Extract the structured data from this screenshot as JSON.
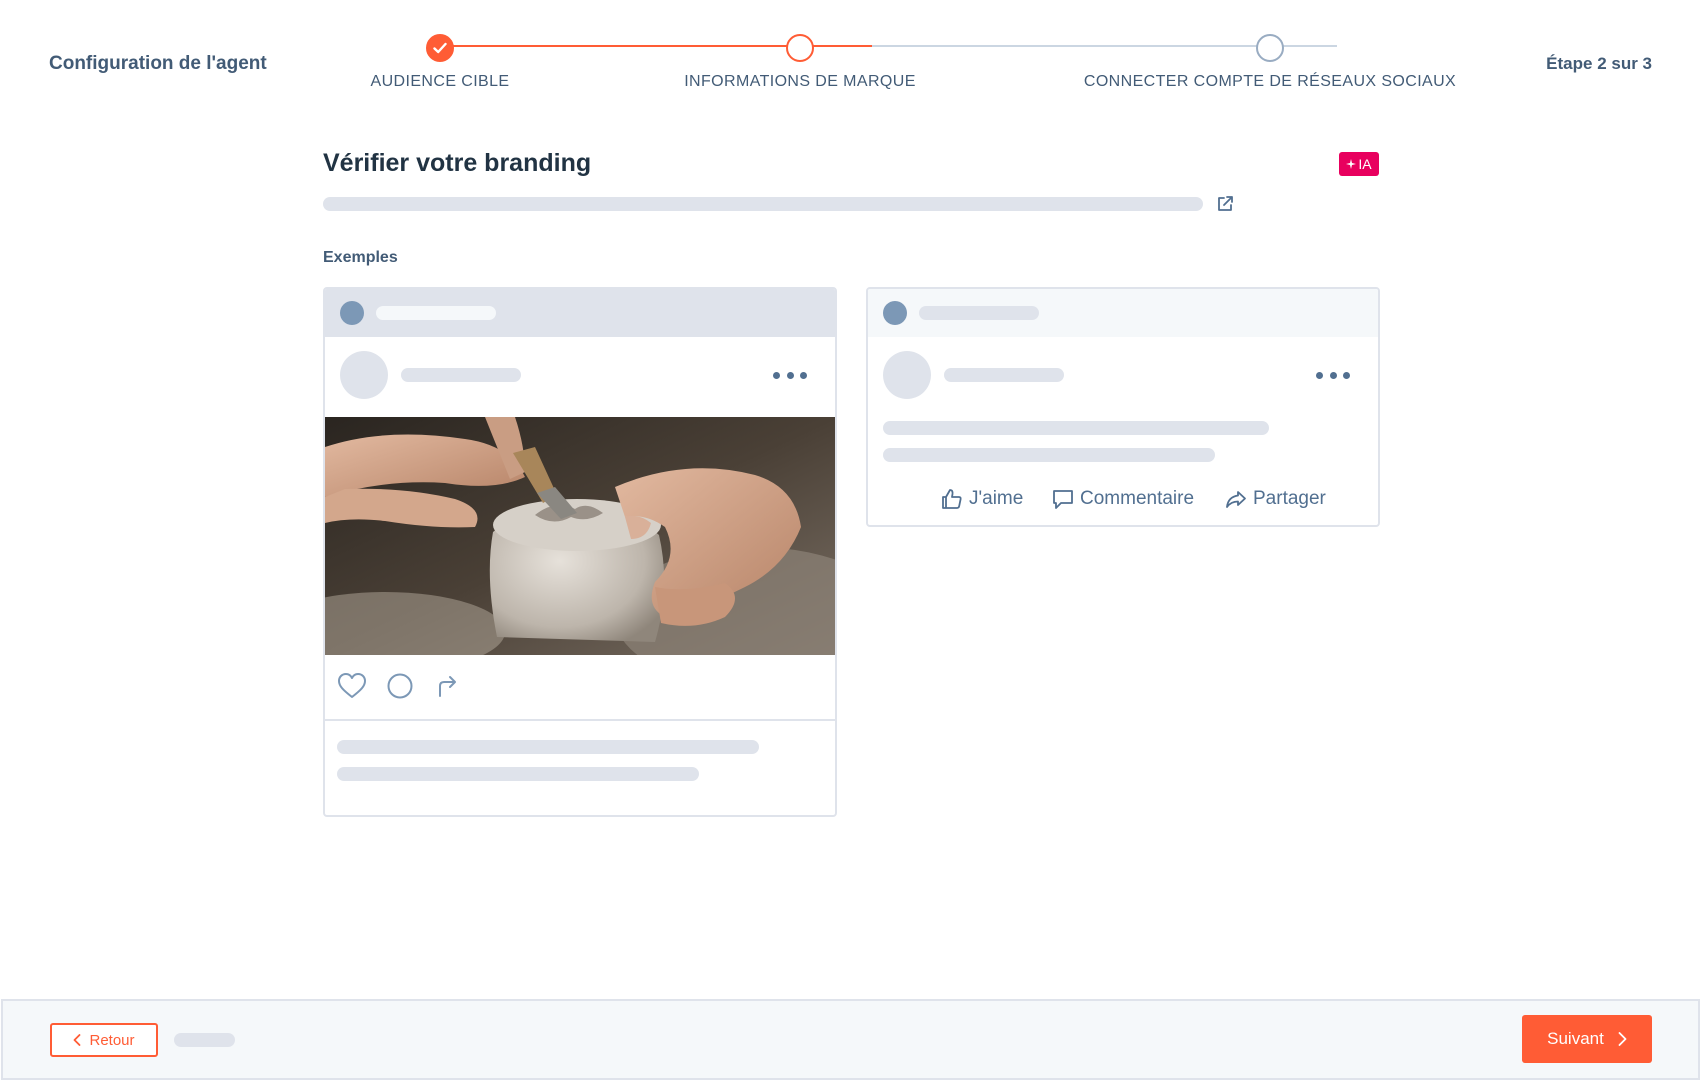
{
  "header": {
    "app_title": "Configuration de l'agent",
    "step_counter": "Étape 2 sur 3"
  },
  "stepper": {
    "steps": [
      {
        "label": "AUDIENCE CIBLE",
        "state": "done"
      },
      {
        "label": "INFORMATIONS DE MARQUE",
        "state": "current"
      },
      {
        "label": "CONNECTER COMPTE DE RÉSEAUX SOCIAUX",
        "state": "todo"
      }
    ]
  },
  "main": {
    "title": "Vérifier votre branding",
    "ai_badge": "IA",
    "examples_label": "Exemples"
  },
  "facebook_post": {
    "like_label": "J'aime",
    "comment_label": "Commentaire",
    "share_label": "Partager"
  },
  "footer": {
    "back_label": "Retour",
    "next_label": "Suivant"
  },
  "colors": {
    "accent": "#ff5c35",
    "ai_badge": "#e8005e",
    "text_dark": "#213343",
    "text_muted": "#425b76",
    "skeleton": "#dfe3eb"
  },
  "icons": {
    "step_done": "check-icon",
    "external_link": "external-link-icon",
    "ai_sparkle": "sparkle-icon",
    "more": "more-dots-icon",
    "heart": "heart-icon",
    "comment": "comment-icon",
    "share": "share-icon",
    "like": "thumbs-up-icon",
    "back": "chevron-left-icon",
    "next": "chevron-right-icon"
  }
}
